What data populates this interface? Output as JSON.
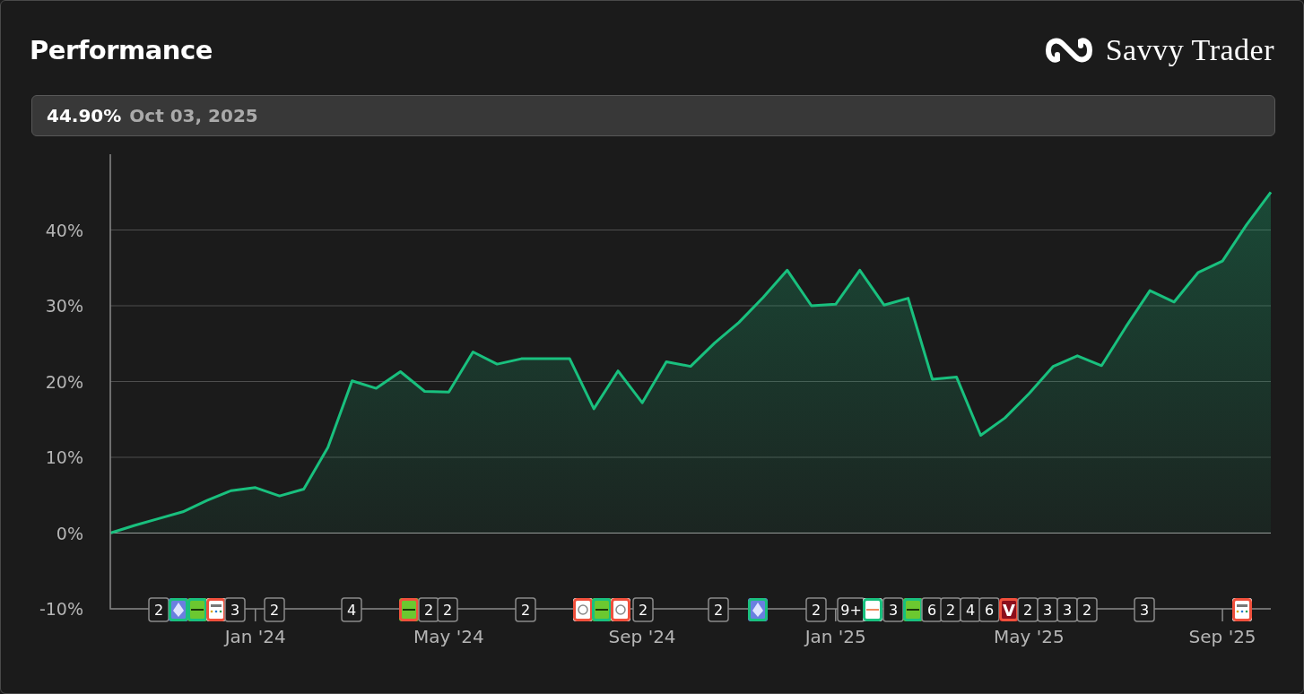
{
  "title": "Performance",
  "brand": {
    "name": "Savvy Trader"
  },
  "summary": {
    "value": "44.90%",
    "date": "Oct 03, 2025"
  },
  "chart_data": {
    "type": "area",
    "grid": true,
    "categories": [
      null,
      null,
      null,
      null,
      null,
      null,
      "Jan '24",
      null,
      null,
      null,
      null,
      null,
      null,
      null,
      "May '24",
      null,
      null,
      null,
      null,
      null,
      null,
      null,
      "Sep '24",
      null,
      null,
      null,
      null,
      null,
      null,
      null,
      "Jan '25",
      null,
      null,
      null,
      null,
      null,
      null,
      null,
      "May '25",
      null,
      null,
      null,
      null,
      null,
      null,
      null,
      "Sep '25",
      null,
      null
    ],
    "series": [
      {
        "color": "#19c07e",
        "values": [
          0,
          1,
          1.9,
          2.8,
          4.3,
          5.6,
          6,
          4.9,
          5.8,
          11.3,
          20.1,
          19.1,
          21.3,
          18.7,
          18.6,
          23.9,
          22.3,
          23,
          23,
          23,
          16.4,
          21.4,
          17.2,
          22.6,
          22,
          25.1,
          27.8,
          31.1,
          34.7,
          30,
          30.2,
          34.7,
          30.1,
          31,
          20.3,
          20.6,
          12.9,
          15.2,
          18.4,
          22,
          23.4,
          22.1,
          27.2,
          32,
          30.5,
          34.4,
          35.9,
          40.7,
          45
        ]
      }
    ],
    "ylim": [
      -10,
      50
    ],
    "yticks": [
      {
        "value": -10,
        "label": "-10%"
      },
      {
        "value": 0,
        "label": "0%"
      },
      {
        "value": 10,
        "label": "10%"
      },
      {
        "value": 20,
        "label": "20%"
      },
      {
        "value": 30,
        "label": "30%"
      },
      {
        "value": 40,
        "label": "40%"
      }
    ]
  },
  "event_markers": [
    {
      "kind": "count",
      "label": "2"
    },
    {
      "kind": "ethereum",
      "color": "#19c07e"
    },
    {
      "kind": "ishares",
      "color": "#19c07e"
    },
    {
      "kind": "uscf",
      "color": "#f0503c"
    },
    {
      "kind": "count",
      "label": "3"
    },
    {
      "kind": "count",
      "label": "2"
    },
    {
      "kind": "count",
      "label": "4"
    },
    {
      "kind": "ishares",
      "color": "#f0503c"
    },
    {
      "kind": "count",
      "label": "2"
    },
    {
      "kind": "count",
      "label": "2"
    },
    {
      "kind": "count",
      "label": "2"
    },
    {
      "kind": "circle",
      "color": "#f0503c"
    },
    {
      "kind": "ishares",
      "color": "#19c07e"
    },
    {
      "kind": "circle",
      "color": "#f0503c"
    },
    {
      "kind": "count",
      "label": "2"
    },
    {
      "kind": "count",
      "label": "2"
    },
    {
      "kind": "ethereum",
      "color": "#19c07e"
    },
    {
      "kind": "count",
      "label": "2"
    },
    {
      "kind": "count",
      "label": "9+"
    },
    {
      "kind": "global",
      "color": "#19c07e"
    },
    {
      "kind": "count",
      "label": "3"
    },
    {
      "kind": "ishares",
      "color": "#19c07e"
    },
    {
      "kind": "count",
      "label": "6"
    },
    {
      "kind": "count",
      "label": "2"
    },
    {
      "kind": "count",
      "label": "4"
    },
    {
      "kind": "count",
      "label": "6"
    },
    {
      "kind": "letter",
      "label": "V",
      "color": "#f0503c"
    },
    {
      "kind": "count",
      "label": "2"
    },
    {
      "kind": "count",
      "label": "3"
    },
    {
      "kind": "count",
      "label": "3"
    },
    {
      "kind": "count",
      "label": "2"
    },
    {
      "kind": "count",
      "label": "3"
    },
    {
      "kind": "uscf",
      "color": "#f0503c"
    }
  ]
}
